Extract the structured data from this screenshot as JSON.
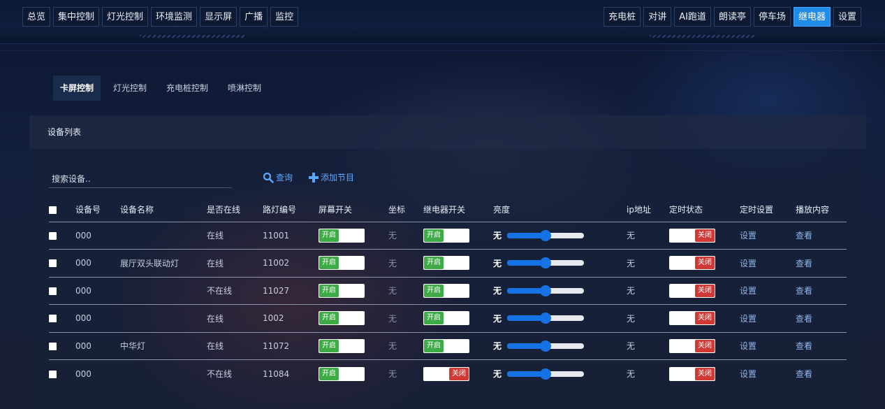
{
  "nav": {
    "left": [
      {
        "label": "总览"
      },
      {
        "label": "集中控制"
      },
      {
        "label": "灯光控制"
      },
      {
        "label": "环境监测"
      },
      {
        "label": "显示屏"
      },
      {
        "label": "广播"
      },
      {
        "label": "监控"
      }
    ],
    "right": [
      {
        "label": "充电桩"
      },
      {
        "label": "对讲"
      },
      {
        "label": "AI跑道"
      },
      {
        "label": "朗读亭"
      },
      {
        "label": "停车场"
      },
      {
        "label": "继电器",
        "active": true
      },
      {
        "label": "设置"
      }
    ]
  },
  "subtabs": [
    {
      "label": "卡屏控制",
      "active": true
    },
    {
      "label": "灯光控制"
    },
    {
      "label": "充电桩控制"
    },
    {
      "label": "喷淋控制"
    }
  ],
  "panel": {
    "title": "设备列表"
  },
  "search": {
    "placeholder": "搜索设备..",
    "query_label": "查询",
    "add_label": "添加节目"
  },
  "columns": [
    "设备号",
    "设备名称",
    "是否在线",
    "路灯编号",
    "屏幕开关",
    "坐标",
    "继电器开关",
    "亮度",
    "ip地址",
    "定时状态",
    "定时设置",
    "播放内容"
  ],
  "rows": [
    {
      "id": "000",
      "name": "",
      "online": "在线",
      "lamp": "11001",
      "screen": "开启",
      "coord": "无",
      "relay": "开启",
      "brightness_label": "无",
      "brightness": 0.5,
      "ip": "无",
      "timer": "关闭",
      "setting": "设置",
      "content": "查看"
    },
    {
      "id": "000",
      "name": "展厅双头联动灯",
      "online": "在线",
      "lamp": "11002",
      "screen": "开启",
      "coord": "无",
      "relay": "开启",
      "brightness_label": "无",
      "brightness": 0.5,
      "ip": "无",
      "timer": "关闭",
      "setting": "设置",
      "content": "查看"
    },
    {
      "id": "000",
      "name": "",
      "online": "不在线",
      "lamp": "11027",
      "screen": "开启",
      "coord": "无",
      "relay": "开启",
      "brightness_label": "无",
      "brightness": 0.5,
      "ip": "无",
      "timer": "关闭",
      "setting": "设置",
      "content": "查看"
    },
    {
      "id": "000",
      "name": "",
      "online": "在线",
      "lamp": "1002",
      "screen": "开启",
      "coord": "无",
      "relay": "开启",
      "brightness_label": "无",
      "brightness": 0.5,
      "ip": "无",
      "timer": "关闭",
      "setting": "设置",
      "content": "查看"
    },
    {
      "id": "000",
      "name": "中华灯",
      "online": "在线",
      "lamp": "11072",
      "screen": "开启",
      "coord": "无",
      "relay": "开启",
      "brightness_label": "无",
      "brightness": 0.5,
      "ip": "无",
      "timer": "关闭",
      "setting": "设置",
      "content": "查看"
    },
    {
      "id": "000",
      "name": "",
      "online": "不在线",
      "lamp": "11084",
      "screen": "开启",
      "coord": "无",
      "relay": "关闭",
      "brightness_label": "无",
      "brightness": 0.5,
      "ip": "无",
      "timer": "关闭",
      "setting": "设置",
      "content": "查看"
    }
  ],
  "colors": {
    "accent": "#1e8ce8",
    "on": "#3fab46",
    "off": "#cf3a37",
    "slider": "#1673e6"
  }
}
